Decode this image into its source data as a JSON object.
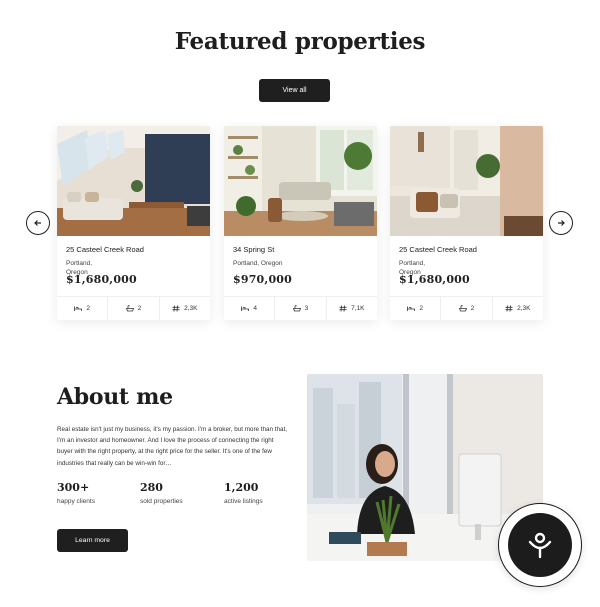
{
  "featured": {
    "title": "Featured properties",
    "view_all_label": "View all",
    "properties": [
      {
        "name": "25 Casteel Creek Road",
        "city": "Portland, Oregon",
        "price": "$1,680,000",
        "beds": "2",
        "baths": "2",
        "area": "2,3K"
      },
      {
        "name": "34 Spring St",
        "city": "Portland, Oregon",
        "price": "$970,000",
        "beds": "4",
        "baths": "3",
        "area": "7,1K"
      },
      {
        "name": "25 Casteel Creek Road",
        "city": "Portland, Oregon",
        "price": "$1,680,000",
        "beds": "2",
        "baths": "2",
        "area": "2,3K"
      }
    ]
  },
  "about": {
    "title": "About me",
    "text": "Real estate isn't just my business, it's my passion. I'm a broker, but more than that, I'm an investor and homeowner. And I love the process of connecting the right buyer with the right property, at the right price for the seller. It's one of the few industries that really can be win-win for…",
    "metrics": [
      {
        "value": "300+",
        "label": "happy clients"
      },
      {
        "value": "280",
        "label": "sold properties"
      },
      {
        "value": "1,200",
        "label": "active listings"
      }
    ],
    "learn_more_label": "Learn more"
  },
  "icons": {
    "prev": "arrow-left-icon",
    "next": "arrow-right-icon",
    "bed": "bed-icon",
    "bath": "bath-icon",
    "area": "area-hash-icon",
    "badge": "person-logo-icon"
  },
  "colors": {
    "dark": "#1f1f1f",
    "background": "#ffffff"
  }
}
